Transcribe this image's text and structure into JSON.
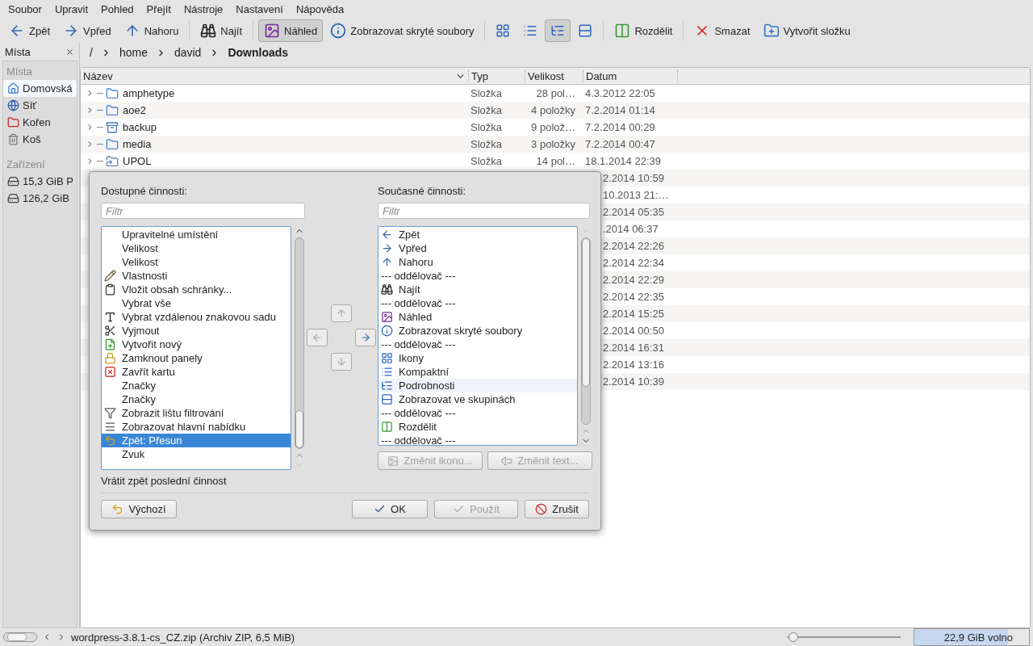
{
  "menu": [
    "Soubor",
    "Upravit",
    "Pohled",
    "Přejít",
    "Nástroje",
    "Nastavení",
    "Nápověda"
  ],
  "toolbar": [
    {
      "kind": "back",
      "label": "Zpět",
      "selected": false
    },
    {
      "kind": "forward",
      "label": "Vpřed",
      "selected": false
    },
    {
      "kind": "up",
      "label": "Nahoru",
      "selected": false
    },
    {
      "kind": "separator"
    },
    {
      "kind": "find",
      "label": "Najít",
      "selected": false
    },
    {
      "kind": "separator"
    },
    {
      "kind": "preview",
      "label": "Náhled",
      "selected": true
    },
    {
      "kind": "hidden",
      "label": "Zobrazovat skryté soubory",
      "selected": false
    },
    {
      "kind": "separator"
    },
    {
      "kind": "view-icons",
      "selected": false
    },
    {
      "kind": "view-compact",
      "selected": false
    },
    {
      "kind": "view-details",
      "selected": true
    },
    {
      "kind": "view-groups",
      "selected": false
    },
    {
      "kind": "separator"
    },
    {
      "kind": "split",
      "label": "Rozdělit",
      "selected": false
    },
    {
      "kind": "separator"
    },
    {
      "kind": "delete",
      "label": "Smazat",
      "selected": false
    },
    {
      "kind": "new-folder",
      "label": "Vytvořit složku",
      "selected": false
    }
  ],
  "sidebar": {
    "title": "Místa",
    "groups": [
      {
        "heading": "Místa",
        "items": [
          {
            "kind": "home",
            "label": "Domovská",
            "selected": true
          },
          {
            "kind": "network",
            "label": "Síť",
            "selected": false
          },
          {
            "kind": "root",
            "label": "Kořen",
            "selected": false
          },
          {
            "kind": "trash",
            "label": "Koš",
            "selected": false
          }
        ]
      },
      {
        "heading": "Zařízení",
        "items": [
          {
            "kind": "drive",
            "label": "15,3 GiB P",
            "selected": false
          },
          {
            "kind": "drive",
            "label": "126,2 GiB",
            "selected": false
          }
        ]
      }
    ]
  },
  "breadcrumb": [
    "/",
    "home",
    "david",
    "Downloads"
  ],
  "table": {
    "columns": [
      "Název",
      "Typ",
      "Velikost",
      "Datum"
    ],
    "rows": [
      {
        "kind": "folder",
        "name": "amphetype",
        "type": "Složka",
        "size": "28 pol…",
        "date": "4.3.2012 22:05"
      },
      {
        "kind": "folder",
        "name": "aoe2",
        "type": "Složka",
        "size": "4 položky",
        "date": "7.2.2014 01:14"
      },
      {
        "kind": "backup",
        "name": "backup",
        "type": "Složka",
        "size": "9 polož…",
        "date": "7.2.2014 00:29"
      },
      {
        "kind": "folder",
        "name": "media",
        "type": "Složka",
        "size": "3 položky",
        "date": "7.2.2014 00:47"
      },
      {
        "kind": "remote",
        "name": "UPOL",
        "type": "Složka",
        "size": "14 pol…",
        "date": "18.1.2014 22:39"
      },
      {
        "kind": "covered",
        "date": "2.2014 10:59"
      },
      {
        "kind": "covered",
        "date": "10.2013 21:…"
      },
      {
        "kind": "covered",
        "date": "2.2014 05:35"
      },
      {
        "kind": "covered",
        "date": ".2014 06:37"
      },
      {
        "kind": "covered",
        "date": "2.2014 22:26"
      },
      {
        "kind": "covered",
        "date": "2.2014 22:34"
      },
      {
        "kind": "covered",
        "date": "2.2014 22:29"
      },
      {
        "kind": "covered",
        "date": "2.2014 22:35"
      },
      {
        "kind": "covered",
        "date": "2.2014 15:25"
      },
      {
        "kind": "covered",
        "date": "2.2014 00:50"
      },
      {
        "kind": "covered",
        "date": "2.2014 16:31"
      },
      {
        "kind": "covered",
        "date": "2.2014 13:16"
      },
      {
        "kind": "covered",
        "date": "2.2014 10:39"
      }
    ]
  },
  "dialog": {
    "available": {
      "label": "Dostupné činnosti:",
      "placeholder": "Filtr",
      "items": [
        {
          "kind": "plain",
          "label": "Upravitelné umístění",
          "selected": false
        },
        {
          "kind": "plain",
          "label": "Velikost",
          "selected": false
        },
        {
          "kind": "plain",
          "label": "Velikost",
          "selected": false
        },
        {
          "kind": "edit",
          "label": "Vlastnosti",
          "selected": false
        },
        {
          "kind": "paste",
          "label": "Vložit obsah schránky...",
          "selected": false
        },
        {
          "kind": "plain",
          "label": "Vybrat vše",
          "selected": false
        },
        {
          "kind": "charset",
          "label": "Vybrat vzdálenou znakovou sadu",
          "selected": false
        },
        {
          "kind": "cut",
          "label": "Vyjmout",
          "selected": false
        },
        {
          "kind": "new",
          "label": "Vytvořit nový",
          "selected": false
        },
        {
          "kind": "lock",
          "label": "Zamknout panely",
          "selected": false
        },
        {
          "kind": "close-tab",
          "label": "Zavřít kartu",
          "selected": false
        },
        {
          "kind": "plain",
          "label": "Značky",
          "selected": false
        },
        {
          "kind": "plain",
          "label": "Značky",
          "selected": false
        },
        {
          "kind": "filter",
          "label": "Zobrazit lištu filtrování",
          "selected": false
        },
        {
          "kind": "menubar",
          "label": "Zobrazovat hlavní nabídku",
          "selected": false
        },
        {
          "kind": "undo",
          "label": "Zpět: Přesun",
          "selected": true
        },
        {
          "kind": "plain",
          "label": "Zvuk",
          "selected": false
        }
      ]
    },
    "move_buttons": [
      {
        "kind": "up",
        "disabled": true
      },
      {
        "kind": "left",
        "disabled": true
      },
      {
        "kind": "right",
        "disabled": false
      },
      {
        "kind": "down",
        "disabled": true
      }
    ],
    "current": {
      "label": "Současné činnosti:",
      "placeholder": "Filtr",
      "items": [
        {
          "kind": "back",
          "label": "Zpět",
          "selected": false
        },
        {
          "kind": "forward",
          "label": "Vpřed",
          "selected": false
        },
        {
          "kind": "up",
          "label": "Nahoru",
          "selected": false
        },
        {
          "kind": "separator",
          "label": "--- oddělovač ---",
          "selected": false
        },
        {
          "kind": "find",
          "label": "Najít",
          "selected": false
        },
        {
          "kind": "separator",
          "label": "--- oddělovač ---",
          "selected": false
        },
        {
          "kind": "preview",
          "label": "Náhled",
          "selected": false
        },
        {
          "kind": "hidden",
          "label": "Zobrazovat skryté soubory",
          "selected": false
        },
        {
          "kind": "separator",
          "label": "--- oddělovač ---",
          "selected": false
        },
        {
          "kind": "view-icons",
          "label": "Ikony",
          "selected": false
        },
        {
          "kind": "view-compact",
          "label": "Kompaktní",
          "selected": false
        },
        {
          "kind": "view-details",
          "label": "Podrobnosti",
          "selected": false,
          "hovered": true
        },
        {
          "kind": "view-groups",
          "label": "Zobrazovat ve skupinách",
          "selected": false
        },
        {
          "kind": "separator",
          "label": "--- oddělovač ---",
          "selected": false
        },
        {
          "kind": "split",
          "label": "Rozdělit",
          "selected": false
        },
        {
          "kind": "separator",
          "label": "--- oddělovač ---",
          "selected": false
        }
      ]
    },
    "edit_buttons": [
      {
        "kind": "icon",
        "label": "Změnit ikonu...",
        "disabled": true
      },
      {
        "kind": "text",
        "label": "Změnit text...",
        "disabled": true
      }
    ],
    "description": "Vrátit zpět poslední činnost",
    "buttons": [
      {
        "kind": "defaults",
        "label": "Výchozí",
        "disabled": false
      },
      {
        "kind": "ok",
        "label": "OK",
        "disabled": false
      },
      {
        "kind": "apply",
        "label": "Použít",
        "disabled": true
      },
      {
        "kind": "cancel",
        "label": "Zrušit",
        "disabled": false
      }
    ]
  },
  "status_bar": {
    "text": "wordpress-3.8.1-cs_CZ.zip (Archiv ZIP, 6,5 MiB)",
    "zoom": {
      "level": 0.05
    },
    "free_space": {
      "text": "22,9 GiB volno",
      "level": 0.82
    }
  }
}
